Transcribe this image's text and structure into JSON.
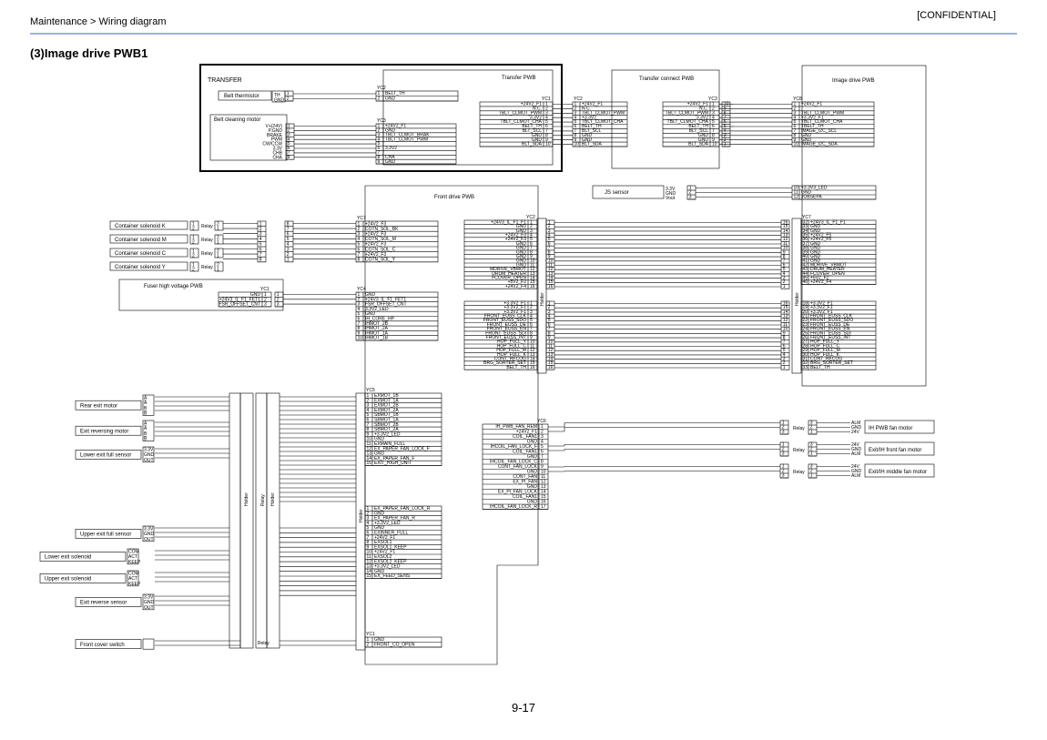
{
  "header": {
    "breadcrumb": "Maintenance > Wiring diagram",
    "classification": "[CONFIDENTIAL]"
  },
  "section_title": "(3)Image drive PWB1",
  "page_number": "9-17",
  "blocks": {
    "transfer": "TRANSFER",
    "transfer_pwb": "Transfer PWB",
    "transfer_connect_pwb": "Transfer connect PWB",
    "image_drive_pwb": "Image drive PWB",
    "front_drive_pwb": "Front drive PWB",
    "belt_thermistor": "Belt thermistor",
    "belt_cleaning_motor": "Belt cleaning motor",
    "js_sensor": "JS sensor",
    "fuser_hv_pwb": "Fuser high voltage PWB",
    "ih_pwb_fan": "IH PWB fan motor",
    "exit_ih_front_fan": "Exit/IH front fan motor",
    "exit_ih_middle_fan": "Exit/IH middle fan motor"
  },
  "components_left": [
    "Container solenoid K",
    "Container solenoid M",
    "Container solenoid C",
    "Container solenoid Y",
    "Rear exit motor",
    "Exit reversing motor",
    "Lower exit full sensor",
    "Upper exit full sensor",
    "Lower exit solenoid",
    "Upper exit solenoid",
    "Exit reverse sensor",
    "Front cover switch"
  ],
  "labels": {
    "relay": "Relay",
    "holder": "Holder"
  },
  "connectors": {
    "yc1": "YC1",
    "yc2": "YC2",
    "yc3": "YC3",
    "yc4": "YC4",
    "yc5": "YC5",
    "yc6": "YC6",
    "yc7": "YC7",
    "yc8": "YC8"
  },
  "signals": {
    "belt_thermistor": [
      "BELT_TH",
      "GND"
    ],
    "belt_cleaning_motor": [
      "+24V2_F1",
      "GND",
      "TBLT_CLMOT_BRAK",
      "TBLT_CLMOT_PWM",
      "",
      "3.3V2",
      "",
      "CHA",
      "GND"
    ],
    "transfer_pwb_yc1": [
      "+24V2_F1",
      "N.C.",
      "TBLT_CLMOT_PWM",
      "3.3V2",
      "TBLT_CLMOT_CHA",
      "BELT_TH",
      "BLT_SCL",
      "GND",
      "GND",
      "BLT_SDA"
    ],
    "transfer_pwb_yc2": [
      "+24V2_F1",
      "N.C.",
      "TBLT_CLMOT_PWM",
      "+3.3V2",
      "TBLT_CLMOT_CHA",
      "BELT_TH",
      "BLT_SCL",
      "GND",
      "GND",
      "BLT_SDA"
    ],
    "connect_yc3": [
      "+24V2_F1",
      "N.C.",
      "TBLT_CLMOT_PWM",
      "3.3V2",
      "TBLT_CLMOT_CHA",
      "BELT_TH",
      "BLT_SCL",
      "GND",
      "GND",
      "BLT_SDA"
    ],
    "image_yc8": [
      "+24V2_F1",
      "",
      "TBLT_CLMOT_PWM",
      "+3.3V2_F1",
      "TBLT_CLMOT_CHA",
      "TBELT_TH",
      "IMAGE_I2C_SCL",
      "GND",
      "GND",
      "IMAGE_I2C_SDA"
    ],
    "js_sensor": [
      "+3.3V3_LED",
      "GND",
      "JOBSEPA"
    ],
    "front_yc7_container": [
      "+24V2_F3",
      "COTN_SOL_BK",
      "+24V2_F3",
      "COTN_SOL_M",
      "+24V2_F3",
      "COTN_SOL_C",
      "+24V2_F3",
      "COTN_SOL_Y"
    ],
    "front_yc4": [
      "GND",
      "+24V3_IL_F1_FET1",
      "FSR_OFFSET_CNT",
      "3.3V2_LED",
      "GND",
      "IH_CORE_HP",
      "IHMOT_2B",
      "IHMOT_2A",
      "IHMOT_1A",
      "IHMOT_1B"
    ],
    "fuser_yc1": [
      "GND",
      "+24V3_IL_F1_FET1",
      "FSR_OFFSET_CNT"
    ],
    "front_yc2_upper": [
      "+24V3_IL_F1_F1",
      "GND",
      "GND",
      "+24V2_F3",
      "+24V2_F3",
      "GND",
      "GND",
      "GND",
      "GND",
      "GND",
      "GND",
      "MDRIVE_VBMOT",
      "DRUM_HEATER",
      "FCOVER_OPEN",
      "+5V2_F2",
      "+24V2_F4"
    ],
    "front_yc2_lower": [
      "+3.3V2_F1",
      "+3.3V2_F1",
      "+3.3V2_F1",
      "FRONT_EUSS_CLK",
      "FRONT_EUSS_SDO",
      "FRONT_EUSS_DE",
      "FRONT_EUSS_EN",
      "FRONT_EUSS_SDI",
      "FRONT_EUSS_INT",
      "HOP_FULL_Y",
      "HOP_FULL_C",
      "HOP_FULL_M",
      "HOP_FULL_K",
      "CONT_RECOG",
      "BRG_SORTER_SET",
      "BELT_TH"
    ],
    "image_yc7_upper": [
      "+24V3_IL_F1_F1",
      "GND",
      "GND",
      "+24V2_F5",
      "+24V2_F5",
      "GND",
      "GND",
      "GND",
      "GND",
      "GND",
      "MDRIVE_VBMOT",
      "DRUM_HEATER",
      "FCOVER_OPEN",
      "+5V2_F2",
      "+24V2_F4"
    ],
    "image_yc7_lower": [
      "+3.3V2_F1",
      "+3.3V2_F1",
      "+3.3V2_F1",
      "FRONT_EUSS_CLK",
      "FRONT_EUSS_SDO",
      "FRONT_EUSS_DE",
      "FRONT_EUSS_EN",
      "FRONT_EUSS_SDI",
      "FRONT_EUSS_INT",
      "HOP_FULL_Y",
      "HOP_FULL_C",
      "HOP_FULL_M",
      "HOP_FULL_K",
      "CONT_RECOG",
      "BRG_SORTER_SET",
      "BELT_TH"
    ],
    "yc5_a": [
      "EXMOT_1B",
      "EXMOT_1A",
      "EXMOT_2B",
      "EXMOT_2A",
      "SBMOT_1B",
      "SBMOT_1A",
      "SBMOT_2B",
      "SBMOT_2A",
      "+3.3V2_LED",
      "GND",
      "EXMAIN_FULL",
      "EX_PAPER_FAN_LOCK_F",
      "GND",
      "EX_PAPER_FAN_F",
      "EXIT_HIGH_UNIT"
    ],
    "yc5_b": [
      "EX_PAPER_FAN_LOCK_R",
      "GND",
      "EX_PAPER_FAN_R",
      "+3.3V2_LED",
      "GND",
      "EXINNER_FULL",
      "+24V2_F1",
      "EXSOL1",
      "EXSOL1_KEEP",
      "+24V2_F1",
      "EXSOL2",
      "EXSOL2_KEEP",
      "+3.3V2_LED",
      "GND",
      "EX_FEED_SENS"
    ],
    "yc6": [
      "IH_PWB_FAN_REM",
      "+24V2_F1",
      "COIL_FAN1",
      "GND",
      "IHCOIL_FAN_LOCK_F",
      "COIL_FAN1",
      "GND",
      "IHCOIL_FAN_LOCK_C",
      "CONT_FAN_LOCK",
      "GND",
      "CONT_FAN",
      "EX_PI_FAN",
      "GND",
      "EX_PI_FAN_LOCK",
      "COIL_FAN1",
      "GND",
      "IHCOIL_FAN_LOCK_R"
    ],
    "front_yc1": [
      "GND",
      "FRONT_CO_OPEN"
    ],
    "fan_ih": [
      "ALM",
      "GND",
      "24V"
    ],
    "fan_front": [
      "24V",
      "GND",
      "ALM"
    ],
    "fan_middle": [
      "24V",
      "GND",
      "ALM"
    ],
    "motor_pins": [
      "A",
      "A̅",
      "B",
      "B̅"
    ],
    "sensor_pins": [
      "3.3V",
      "GND",
      "OUT"
    ],
    "solenoid_pins": [
      "COM",
      "ACT",
      "KEEP"
    ],
    "motor_cleaning_pins": [
      "V+(24V)",
      "P.GND",
      "BRAKE",
      "PWM",
      "CW/CCW",
      "3.3V",
      "CHB",
      "CHA"
    ],
    "js_pins": [
      "3.3V",
      "GND",
      "Vout"
    ],
    "th_pins": [
      "TH",
      "GND"
    ]
  }
}
